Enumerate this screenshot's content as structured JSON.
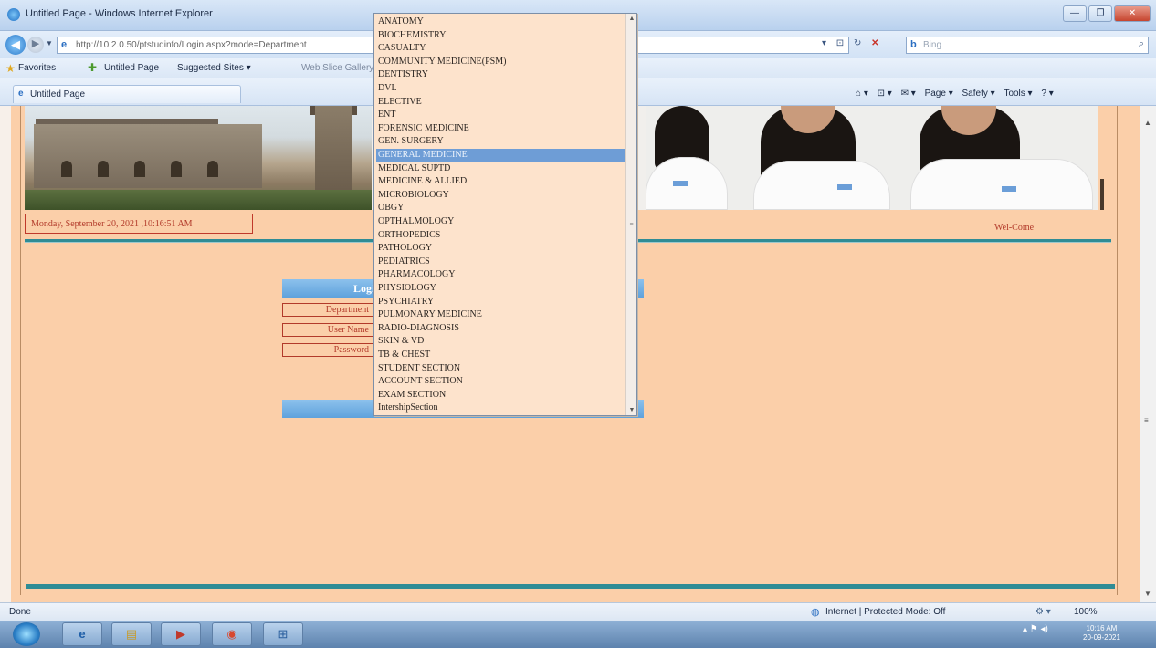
{
  "window": {
    "title": "Untitled Page - Windows Internet Explorer",
    "buttons": [
      "—",
      "❐",
      "✕"
    ]
  },
  "address": {
    "back_glyph": "◀",
    "forward_glyph": "▶",
    "url": "http://10.2.0.50/ptstudinfo/Login.aspx?mode=Department",
    "search_placeholder": "Bing",
    "tools": "▾ ⊡ ↻",
    "stop_glyph": "✕"
  },
  "favorites": {
    "label": "Favorites",
    "items": [
      "Untitled Page",
      "Suggested Sites ▾",
      "Web Slice Gallery ▾"
    ]
  },
  "tab": {
    "label": "Untitled Page"
  },
  "command_bar": {
    "items": [
      "⌂ ▾",
      "⊡ ▾",
      "✉ ▾",
      "Page ▾",
      "Safety ▾",
      "Tools ▾",
      "? ▾"
    ]
  },
  "page": {
    "date_text": "Monday, September 20, 2021 ,10:16:51 AM",
    "welcome_text": "Wel-Come",
    "login": {
      "title": "Login",
      "department_label": "Department",
      "username_label": "User Name",
      "password_label": "Password"
    }
  },
  "dropdown": {
    "options": [
      "ANATOMY",
      "BIOCHEMISTRY",
      "CASUALTY",
      "COMMUNITY MEDICINE(PSM)",
      "DENTISTRY",
      "DVL",
      "ELECTIVE",
      "ENT",
      "FORENSIC MEDICINE",
      "GEN. SURGERY",
      "GENERAL MEDICINE",
      "MEDICAL SUPTD",
      "MEDICINE & ALLIED",
      "MICROBIOLOGY",
      "OBGY",
      "OPTHALMOLOGY",
      "ORTHOPEDICS",
      "PATHOLOGY",
      "PEDIATRICS",
      "PHARMACOLOGY",
      "PHYSIOLOGY",
      "PSYCHIATRY",
      "PULMONARY MEDICINE",
      "RADIO-DIAGNOSIS",
      "SKIN & VD",
      "TB & CHEST",
      "STUDENT SECTION",
      "ACCOUNT SECTION",
      "EXAM SECTION",
      "IntershipSection"
    ],
    "selected": "GENERAL MEDICINE"
  },
  "status": {
    "text": "Done",
    "zone": "Internet | Protected Mode: Off",
    "security": "⚙ ▾",
    "zoom": "100%"
  },
  "taskbar": {
    "items": [
      "e",
      "▤",
      "▶",
      "◉",
      "⊞"
    ],
    "tray": "▴ ⚑ ◂)",
    "time": "10:16 AM",
    "date": "20-09-2021"
  },
  "colors": {
    "page_bg": "#fbcfa9",
    "accent_teal": "#2f8c95",
    "label_red": "#b23a2a",
    "selection_blue": "#6e9dd6",
    "login_header_blue": "#6aa8df"
  }
}
